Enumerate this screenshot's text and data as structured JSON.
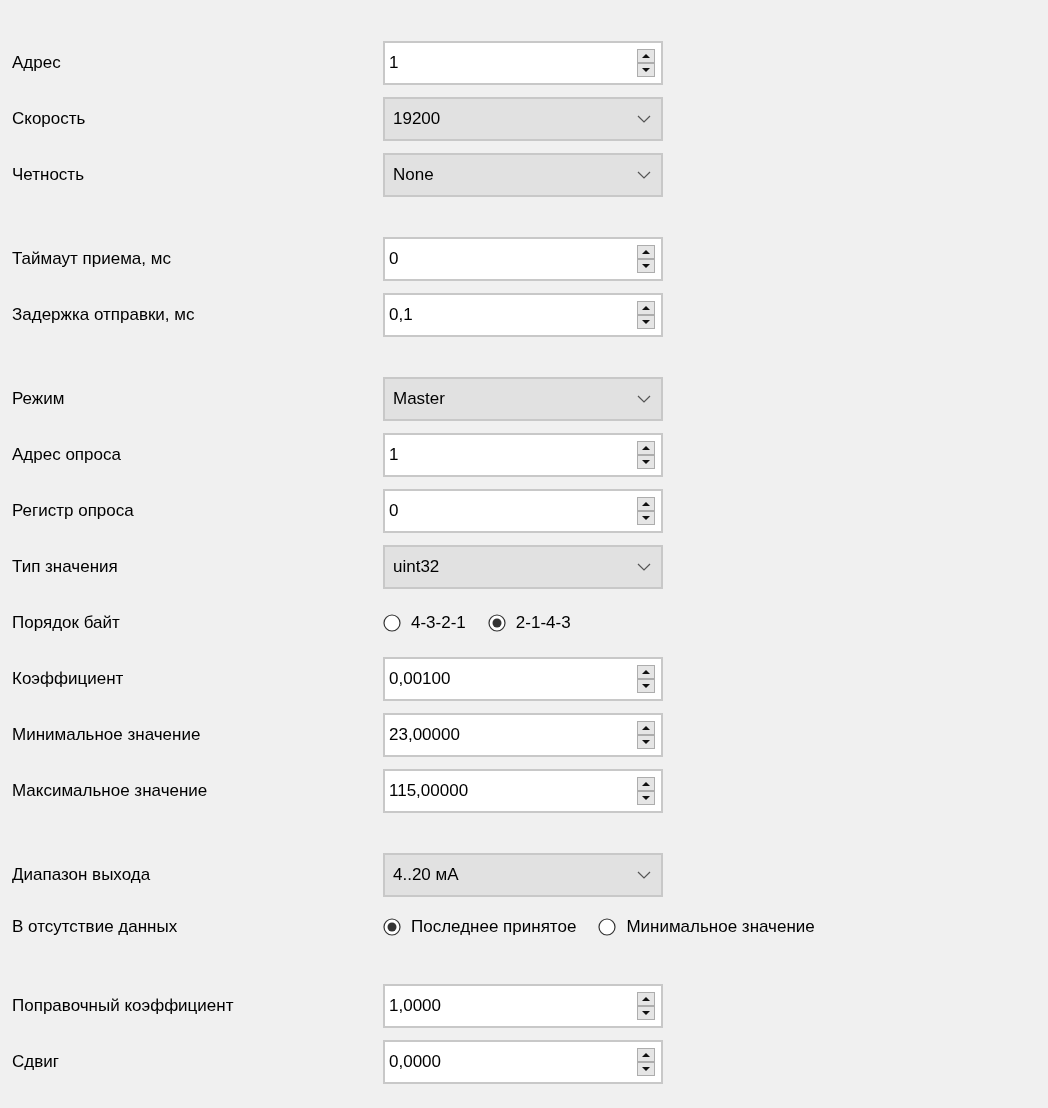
{
  "groups": [
    {
      "rows": [
        {
          "kind": "spin",
          "label": "Адрес",
          "value": "1"
        },
        {
          "kind": "combo",
          "label": "Скорость",
          "value": "19200"
        },
        {
          "kind": "combo",
          "label": "Четность",
          "value": "None"
        }
      ]
    },
    {
      "rows": [
        {
          "kind": "spin",
          "label": "Таймаут приема, мс",
          "value": "0"
        },
        {
          "kind": "spin",
          "label": "Задержка отправки, мс",
          "value": "0,1"
        }
      ]
    },
    {
      "rows": [
        {
          "kind": "combo",
          "label": "Режим",
          "value": "Master"
        },
        {
          "kind": "spin",
          "label": "Адрес опроса",
          "value": "1"
        },
        {
          "kind": "spin",
          "label": "Регистр опроса",
          "value": "0"
        },
        {
          "kind": "combo",
          "label": "Тип значения",
          "value": "uint32"
        },
        {
          "kind": "radio",
          "label": "Порядок байт",
          "options": [
            {
              "label": "4-3-2-1",
              "selected": false
            },
            {
              "label": "2-1-4-3",
              "selected": true
            }
          ]
        },
        {
          "kind": "spin",
          "label": "Коэффициент",
          "value": "0,00100"
        },
        {
          "kind": "spin",
          "label": "Минимальное значение",
          "value": "23,00000"
        },
        {
          "kind": "spin",
          "label": "Максимальное значение",
          "value": "115,00000"
        }
      ]
    },
    {
      "rows": [
        {
          "kind": "combo",
          "label": "Диапазон выхода",
          "value": "4..20 мА"
        },
        {
          "kind": "radio",
          "label": "В отсутствие данных",
          "options": [
            {
              "label": "Последнее принятое",
              "selected": true
            },
            {
              "label": "Минимальное значение",
              "selected": false
            }
          ]
        }
      ]
    },
    {
      "rows": [
        {
          "kind": "spin",
          "label": "Поправочный коэффициент",
          "value": "1,0000"
        },
        {
          "kind": "spin",
          "label": "Сдвиг",
          "value": "0,0000"
        }
      ]
    }
  ]
}
